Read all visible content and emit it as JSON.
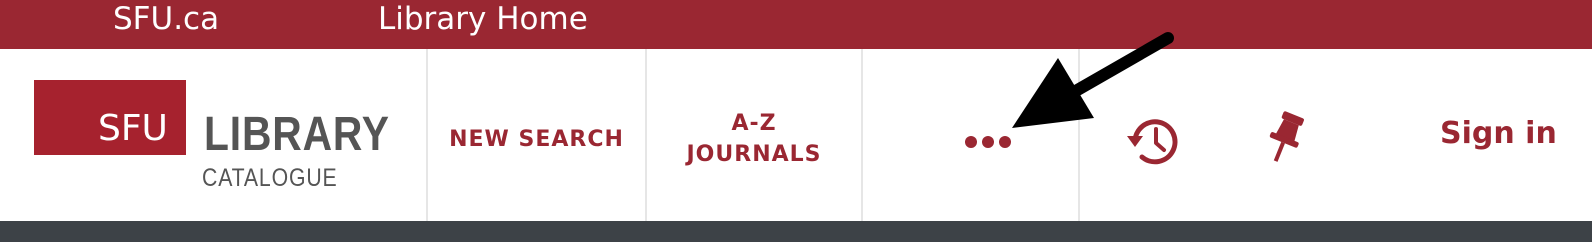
{
  "top_bar": {
    "links": [
      {
        "label": "SFU.ca"
      },
      {
        "label": "Library Home"
      }
    ]
  },
  "logo": {
    "box_text": "SFU",
    "title": "LIBRARY",
    "subtitle": "CATALOGUE"
  },
  "nav": {
    "new_search": "NEW SEARCH",
    "az_journals_line1": "A-Z",
    "az_journals_line2": "JOURNALS",
    "more_icon": "ellipsis-icon"
  },
  "actions": {
    "history_icon": "history-icon",
    "pin_icon": "pushpin-icon",
    "sign_in": "Sign in"
  },
  "annotation": {
    "arrow_icon": "black-arrow-icon"
  },
  "colors": {
    "brand": "#9a2732",
    "logo_red": "#a6222e",
    "logo_gray": "#555555",
    "bottom_bar": "#3d4247",
    "divider": "#e6e6e6"
  }
}
